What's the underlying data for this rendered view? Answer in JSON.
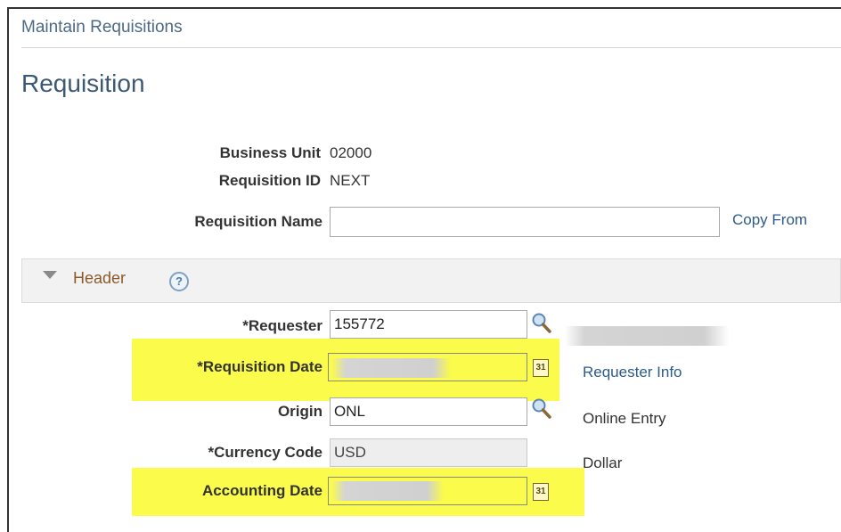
{
  "breadcrumb": "Maintain Requisitions",
  "page_title": "Requisition",
  "info": {
    "business_unit_label": "Business Unit",
    "business_unit_value": "02000",
    "requisition_id_label": "Requisition ID",
    "requisition_id_value": "NEXT",
    "requisition_name_label": "Requisition Name",
    "requisition_name_value": "",
    "copy_from_link": "Copy From"
  },
  "header_section": {
    "title": "Header",
    "help_icon_text": "?"
  },
  "fields": {
    "requester_label": "*Requester",
    "requester_value": "155772",
    "requisition_date_label": "*Requisition Date",
    "requisition_date_value": "",
    "requester_info_link": "Requester Info",
    "origin_label": "Origin",
    "origin_value": "ONL",
    "origin_description": "Online Entry",
    "currency_code_label": "*Currency Code",
    "currency_code_value": "USD",
    "currency_description": "Dollar",
    "accounting_date_label": "Accounting Date",
    "accounting_date_value": "",
    "calendar_icon_text": "31"
  },
  "colors": {
    "highlight": "#fbfb4b",
    "link": "#2d5b8a",
    "title": "#3c5874"
  }
}
